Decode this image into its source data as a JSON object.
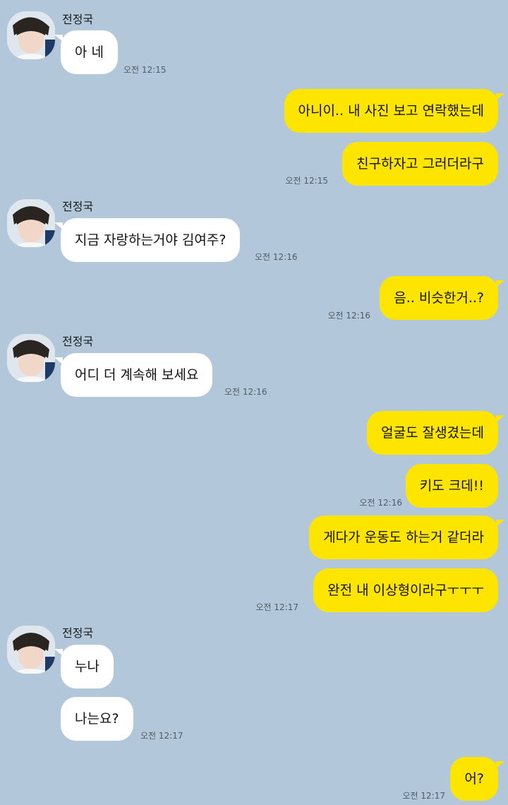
{
  "contact": {
    "name": "전정국"
  },
  "messages": [
    {
      "dir": "in",
      "sender": "전정국",
      "text": "아 네",
      "time": "오전 12:15"
    },
    {
      "dir": "out",
      "text": "아니이.. 내 사진 보고 연락했는데"
    },
    {
      "dir": "out",
      "text": "친구하자고 그러더라구",
      "time": "오전 12:15"
    },
    {
      "dir": "in",
      "sender": "전정국",
      "text": "지금 자랑하는거야 김여주?",
      "time": "오전 12:16"
    },
    {
      "dir": "out",
      "text": "음.. 비슷한거..?",
      "time": "오전 12:16"
    },
    {
      "dir": "in",
      "sender": "전정국",
      "text": "어디 더 계속해 보세요",
      "time": "오전 12:16"
    },
    {
      "dir": "out",
      "text": "얼굴도 잘생겼는데"
    },
    {
      "dir": "out",
      "text": "키도 크데!!",
      "time": "오전 12:16"
    },
    {
      "dir": "out",
      "text": "게다가 운동도 하는거 같더라"
    },
    {
      "dir": "out",
      "text": "완전 내 이상형이라구ㅜㅜㅜ",
      "time": "오전 12:17"
    },
    {
      "dir": "in",
      "sender": "전정국",
      "text": "누나"
    },
    {
      "dir": "in",
      "text": "나는요?",
      "time": "오전 12:17"
    },
    {
      "dir": "out",
      "text": "어?",
      "time": "오전 12:17"
    }
  ],
  "colors": {
    "background": "#b2c7d9",
    "incoming": "#ffffff",
    "outgoing": "#fee500"
  }
}
